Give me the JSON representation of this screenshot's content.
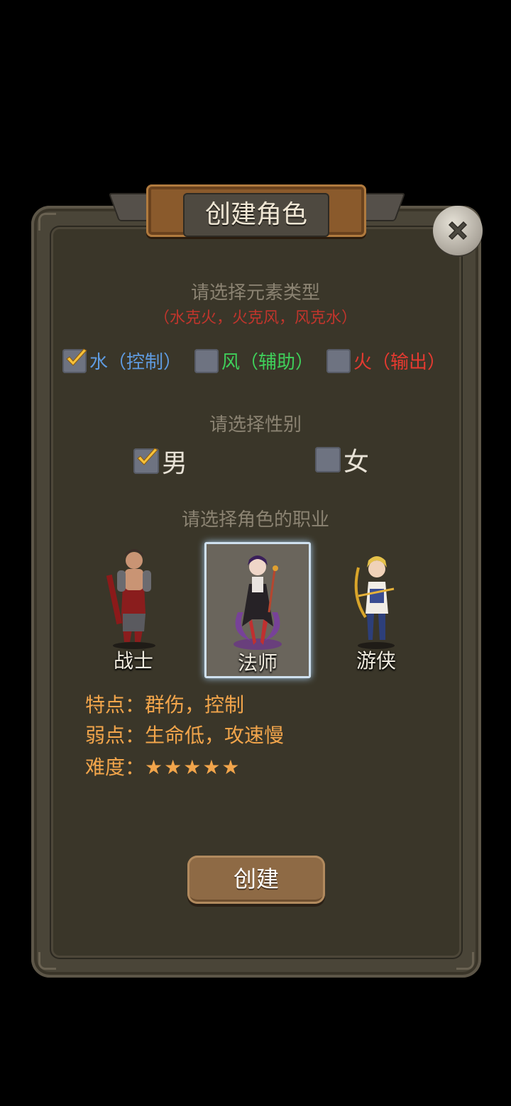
{
  "dialog": {
    "title": "创建角色",
    "close_icon": "close-x-icon"
  },
  "element": {
    "prompt": "请选择元素类型",
    "counter_hint": "（水克火，火克风，风克水）",
    "options": [
      {
        "label": "水（控制）",
        "checked": true,
        "color": "#5f9be0"
      },
      {
        "label": "风（辅助）",
        "checked": false,
        "color": "#3fcf5a"
      },
      {
        "label": "火（输出）",
        "checked": false,
        "color": "#e53a30"
      }
    ]
  },
  "gender": {
    "prompt": "请选择性别",
    "options": [
      {
        "label": "男",
        "checked": true
      },
      {
        "label": "女",
        "checked": false
      }
    ]
  },
  "class": {
    "prompt": "请选择角色的职业",
    "options": [
      {
        "name": "战士",
        "selected": false
      },
      {
        "name": "法师",
        "selected": true
      },
      {
        "name": "游侠",
        "selected": false
      }
    ]
  },
  "details": {
    "traits": "特点：群伤，控制",
    "weakness": "弱点：生命低，攻速慢",
    "difficulty_label": "难度：",
    "difficulty_stars": "★★★★★",
    "difficulty_value": 5
  },
  "actions": {
    "create_label": "创建"
  },
  "colors": {
    "check_mark": "#f6c13a",
    "info_text": "#f2a54b",
    "counter_hint": "#c0352c"
  }
}
